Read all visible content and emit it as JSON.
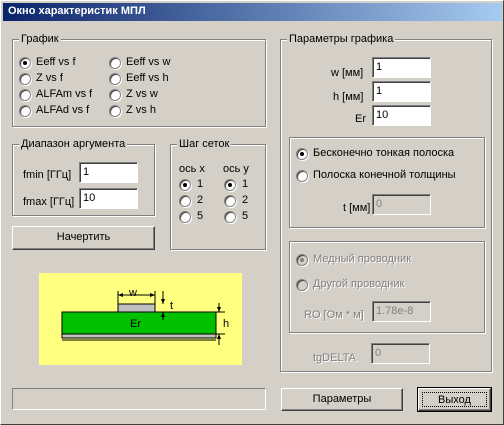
{
  "window": {
    "title": "Окно характеристик МПЛ"
  },
  "graph_group": {
    "title": "График",
    "options": [
      {
        "label": "Eeff vs f",
        "checked": true
      },
      {
        "label": "Z vs f",
        "checked": false
      },
      {
        "label": "ALFAm vs f",
        "checked": false
      },
      {
        "label": "ALFAd vs f",
        "checked": false
      },
      {
        "label": "Eeff vs w",
        "checked": false
      },
      {
        "label": "Eeff vs h",
        "checked": false
      },
      {
        "label": "Z vs w",
        "checked": false
      },
      {
        "label": "Z vs h",
        "checked": false
      }
    ]
  },
  "range_group": {
    "title": "Диапазон аргумента",
    "fmin_label": "fmin [ГГц]",
    "fmin_value": "1",
    "fmax_label": "fmax [ГГц]",
    "fmax_value": "10"
  },
  "grid_group": {
    "title": "Шаг сеток",
    "x_axis_label": "ось x",
    "y_axis_label": "ось y",
    "x_options": [
      {
        "label": "1",
        "checked": true
      },
      {
        "label": "2",
        "checked": false
      },
      {
        "label": "5",
        "checked": false
      }
    ],
    "y_options": [
      {
        "label": "1",
        "checked": true
      },
      {
        "label": "2",
        "checked": false
      },
      {
        "label": "5",
        "checked": false
      }
    ]
  },
  "draw_button": "Начертить",
  "diagram": {
    "w_label": "w",
    "t_label": "t",
    "h_label": "h",
    "er_label": "Er"
  },
  "params_group": {
    "title": "Параметры графика",
    "w_label": "w [мм]",
    "w_value": "1",
    "h_label": "h [мм]",
    "h_value": "1",
    "er_label": "Er",
    "er_value": "10",
    "strip_options": [
      {
        "label": "Бесконечно тонкая полоска",
        "checked": true
      },
      {
        "label": "Полоска конечной толщины",
        "checked": false
      }
    ],
    "t_label": "t [мм]",
    "t_value": "0",
    "conductor_options": [
      {
        "label": "Медный проводник",
        "checked": true
      },
      {
        "label": "Другой проводник",
        "checked": false
      }
    ],
    "ro_label": "RO [Ом * м]",
    "ro_value": "1.78e-8",
    "tgdelta_label": "tgDELTA",
    "tgdelta_value": "0"
  },
  "buttons": {
    "params": "Параметры",
    "exit": "Выход"
  },
  "colors": {
    "diagram_bg": "#ffff80",
    "substrate": "#00c000",
    "strip": "#c0c0c0",
    "title_start": "#0a246a",
    "title_end": "#a6caf0"
  }
}
